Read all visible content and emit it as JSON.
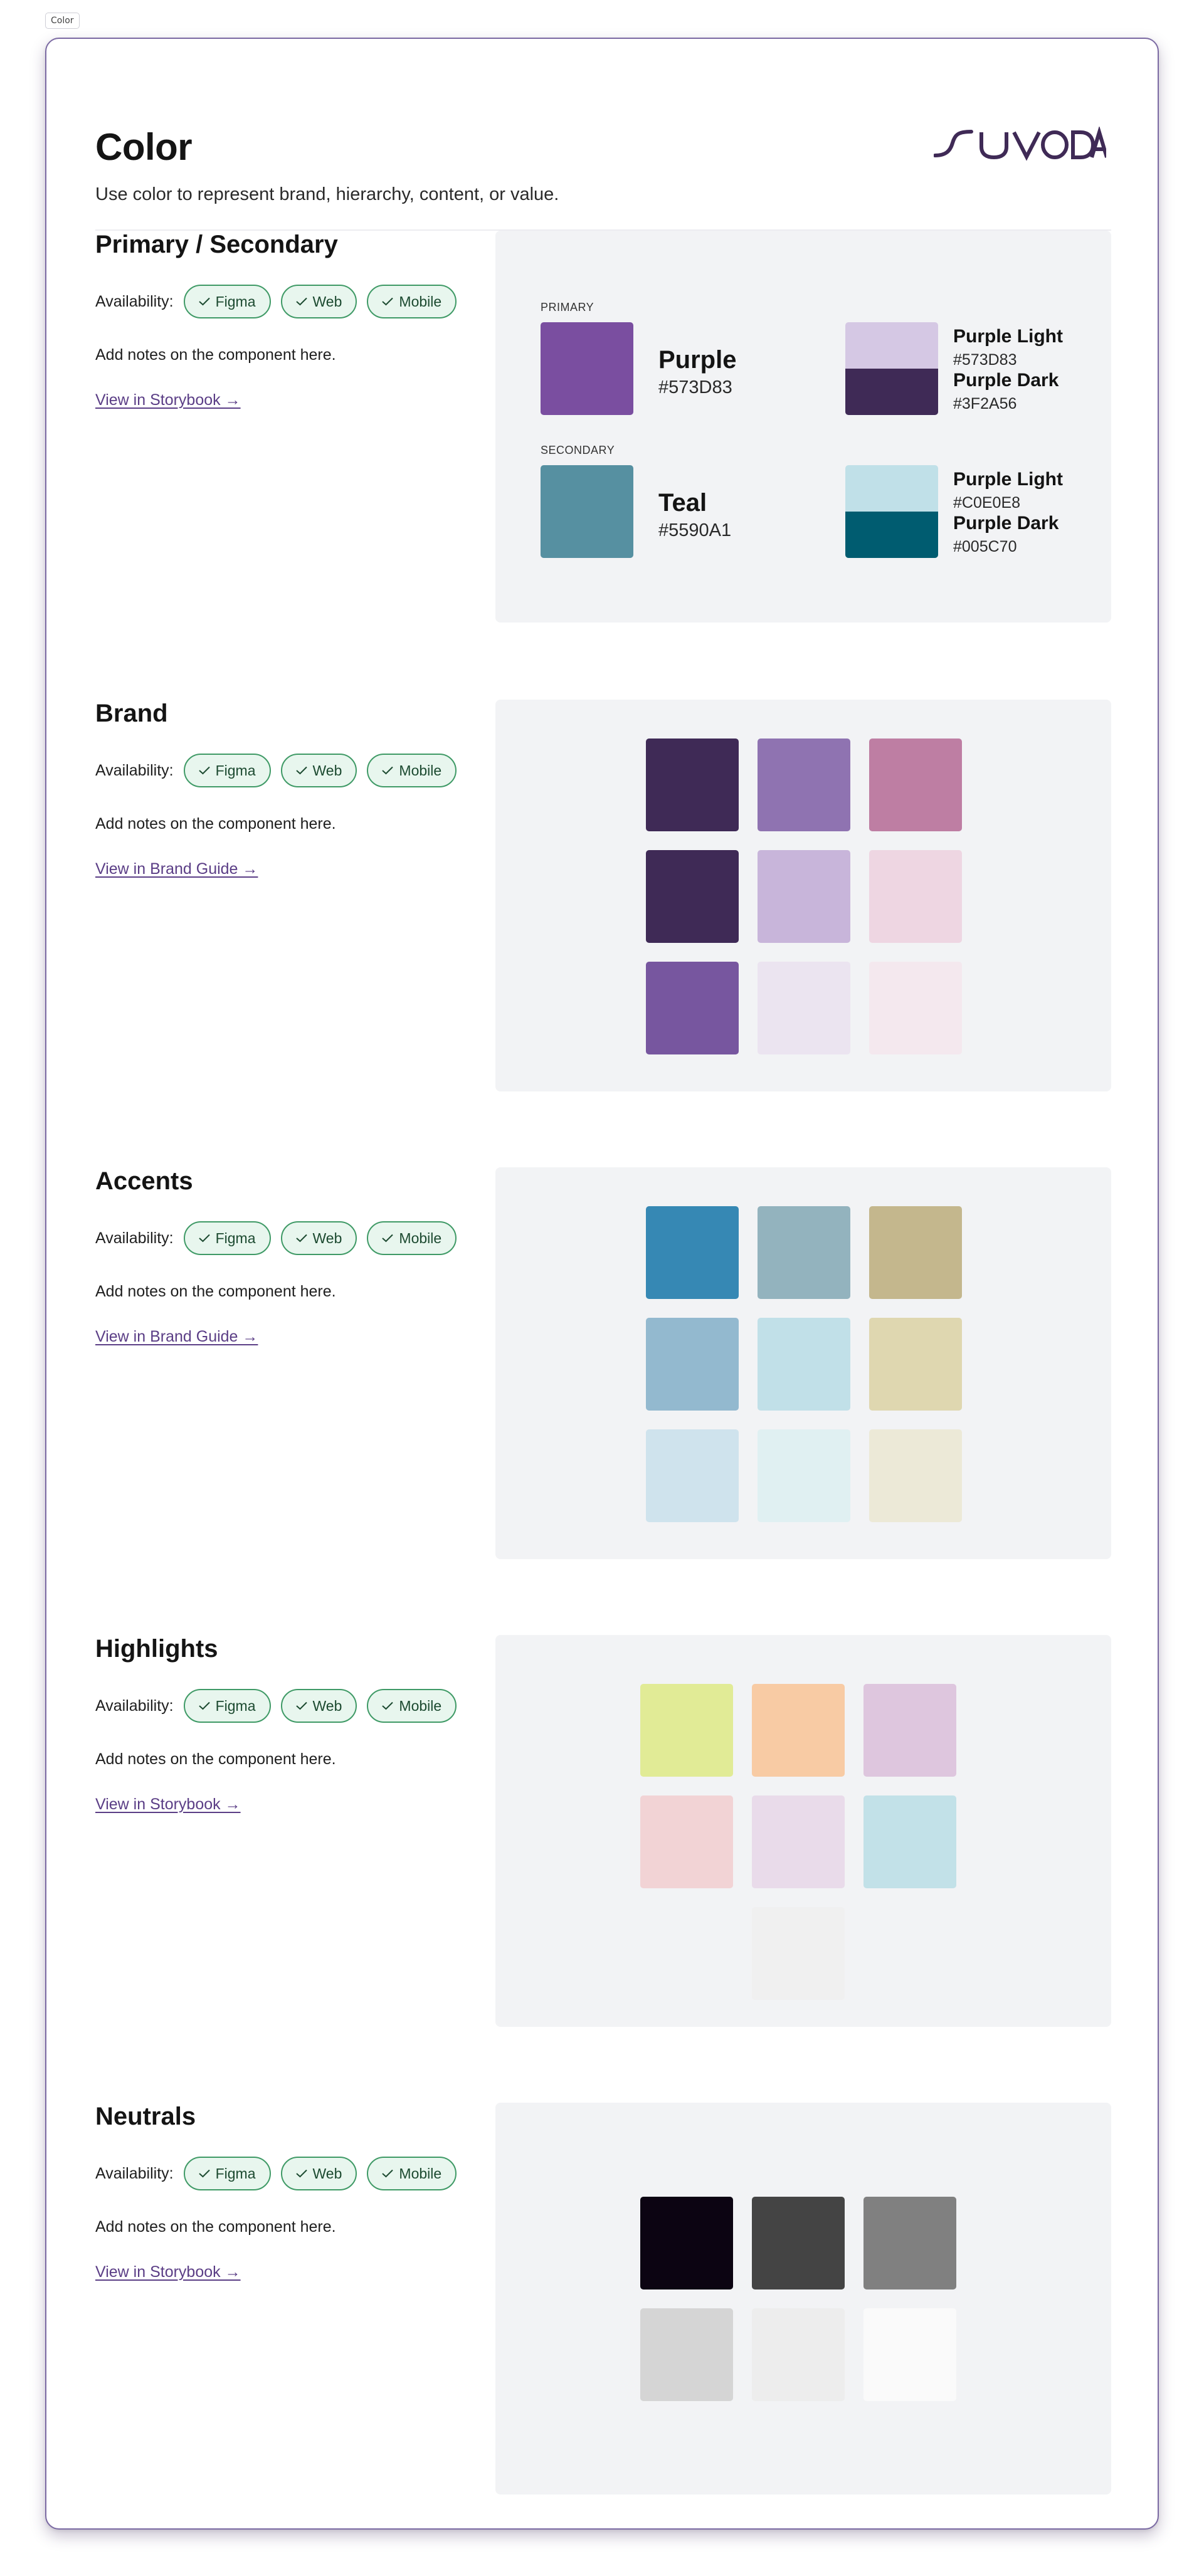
{
  "frame_tag": "Color",
  "header": {
    "title": "Color",
    "subtitle": "Use color to represent brand, hierarchy, content, or value.",
    "logo_text": "SUVODA"
  },
  "availability_label": "Availability:",
  "pills": [
    "Figma",
    "Web",
    "Mobile"
  ],
  "notes_text": "Add notes on the component here.",
  "sections": {
    "primary": {
      "title": "Primary / Secondary",
      "link": "View in Storybook →",
      "primary_label": "PRIMARY",
      "secondary_label": "SECONDARY",
      "primary_color": {
        "name": "Purple",
        "hex": "#573D83",
        "swatch": "#7a4ea0"
      },
      "primary_light": {
        "name": "Purple Light",
        "hex": "#573D83",
        "swatch": "#d5c8e4"
      },
      "primary_dark": {
        "name": "Purple Dark",
        "hex": "#3F2A56",
        "swatch": "#3f2a56"
      },
      "secondary_color": {
        "name": "Teal",
        "hex": "#5590A1",
        "swatch": "#5690a1"
      },
      "secondary_light": {
        "name": "Purple Light",
        "hex": "#C0E0E8",
        "swatch": "#c0e0e8"
      },
      "secondary_dark": {
        "name": "Purple Dark",
        "hex": "#005C70",
        "swatch": "#005c70"
      }
    },
    "brand": {
      "title": "Brand",
      "link": "View in Brand Guide →",
      "colors": [
        "#3f2a56",
        "#8f73b1",
        "#be7ea3",
        "#3f2a56",
        "#c8b5da",
        "#eed6e2",
        "#77569f",
        "#ebe4f0",
        "#f4e8ee"
      ]
    },
    "accents": {
      "title": "Accents",
      "link": "View in Brand Guide →",
      "colors": [
        "#3688b4",
        "#93b3be",
        "#c4b78d",
        "#93b9cf",
        "#c1e0e8",
        "#dfd7b0",
        "#cfe3ed",
        "#e0f0f2",
        "#ece9d7"
      ]
    },
    "highlights": {
      "title": "Highlights",
      "link": "View in Storybook →",
      "colors": [
        "#e1eb96",
        "#f8cba4",
        "#dec6de",
        "#f2d3d5",
        "#e9dbea",
        "#c2e1e8",
        "#f0f0f0"
      ]
    },
    "neutrals": {
      "title": "Neutrals",
      "link": "View in Storybook →",
      "colors": [
        "#0c0412",
        "#444444",
        "#808080",
        "#d5d5d5",
        "#ededed",
        "#fafafa"
      ]
    }
  }
}
